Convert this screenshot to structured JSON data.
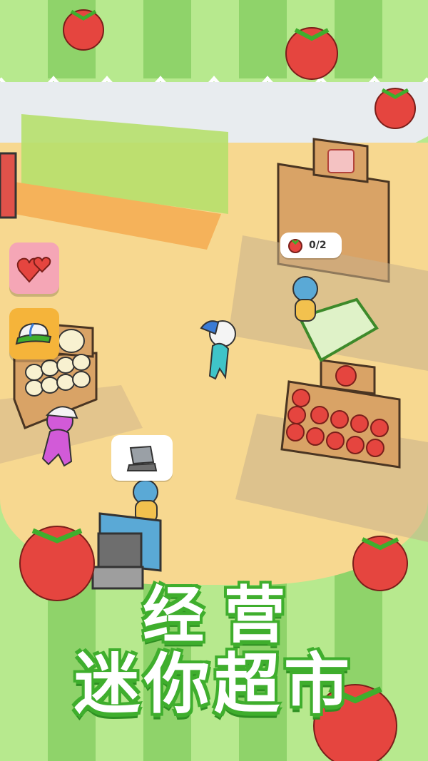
{
  "title": {
    "line1": "经营",
    "line2": "迷你超市"
  },
  "order": {
    "item_icon": "tomato-icon",
    "progress_text": "0/2"
  },
  "hud": {
    "hearts_icon": "hearts-icon",
    "cap_icon": "cap-icon"
  },
  "register_bubble_icon": "cash-register-icon",
  "colors": {
    "stripe_light": "#b7e98e",
    "stripe_dark": "#8fd36a",
    "floor": "#f7d890",
    "title_outline": "#3fae2d",
    "tomato": "#e5453f"
  }
}
